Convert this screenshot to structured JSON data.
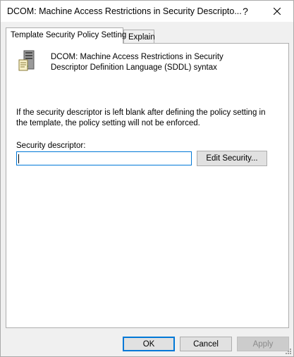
{
  "window": {
    "title": "DCOM: Machine Access Restrictions in Security Descripto...",
    "help_label": "?",
    "close_label": "✕"
  },
  "tabs": [
    {
      "label": "Template Security Policy Setting",
      "active": true
    },
    {
      "label": "Explain",
      "active": false
    }
  ],
  "policy": {
    "icon": "server-policy-icon",
    "title": "DCOM: Machine Access Restrictions in Security Descriptor Definition Language (SDDL) syntax"
  },
  "note": "If the security descriptor is left blank after defining the policy setting in the template, the policy setting will not be enforced.",
  "security_descriptor": {
    "label": "Security descriptor:",
    "value": "",
    "edit_button_label": "Edit Security..."
  },
  "footer": {
    "ok_label": "OK",
    "cancel_label": "Cancel",
    "apply_label": "Apply"
  },
  "colors": {
    "focus_border": "#0078d7",
    "button_face": "#e1e1e1",
    "disabled_text": "#8a8a8a"
  }
}
